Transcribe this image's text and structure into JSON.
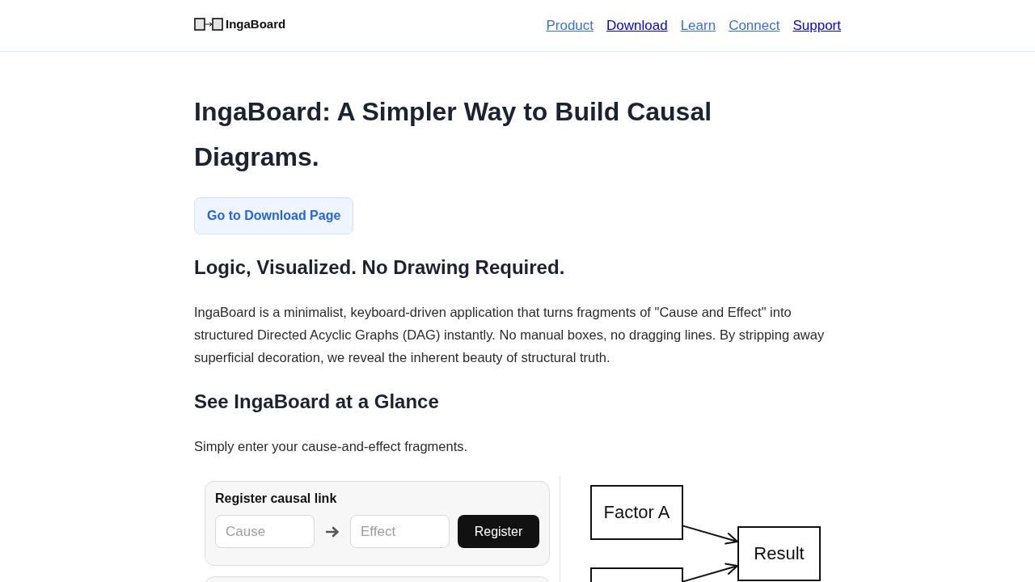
{
  "header": {
    "logo": {
      "text": "IngaBoard"
    },
    "nav": [
      {
        "label": "Product",
        "kind": "accent"
      },
      {
        "label": "Download",
        "kind": "plain"
      },
      {
        "label": "Learn",
        "kind": "accent"
      },
      {
        "label": "Connect",
        "kind": "accent"
      },
      {
        "label": "Support",
        "kind": "plain"
      }
    ]
  },
  "hero": {
    "title": "IngaBoard: A Simpler Way to Build Causal Diagrams.",
    "cta": "Go to Download Page"
  },
  "sections": [
    {
      "heading": "Logic, Visualized. No Drawing Required.",
      "text": "IngaBoard is a minimalist, keyboard-driven application that turns fragments of \"Cause and Effect\" into structured Directed Acyclic Graphs (DAG) instantly. No manual boxes, no dragging lines. By stripping away superficial decoration, we reveal the inherent beauty of structural truth."
    },
    {
      "heading": "See IngaBoard at a Glance",
      "text": "Simply enter your cause-and-effect fragments."
    }
  ],
  "demo": {
    "form": {
      "title": "Register causal link",
      "fields": [
        {
          "placeholder": "Cause"
        },
        {
          "placeholder": "Effect"
        }
      ],
      "button": "Register"
    },
    "diagram": {
      "nodes": [
        {
          "kind": "cause",
          "label": "Factor A"
        },
        {
          "kind": "effect",
          "label": "Result"
        },
        {
          "kind": "cause"
        }
      ]
    }
  }
}
